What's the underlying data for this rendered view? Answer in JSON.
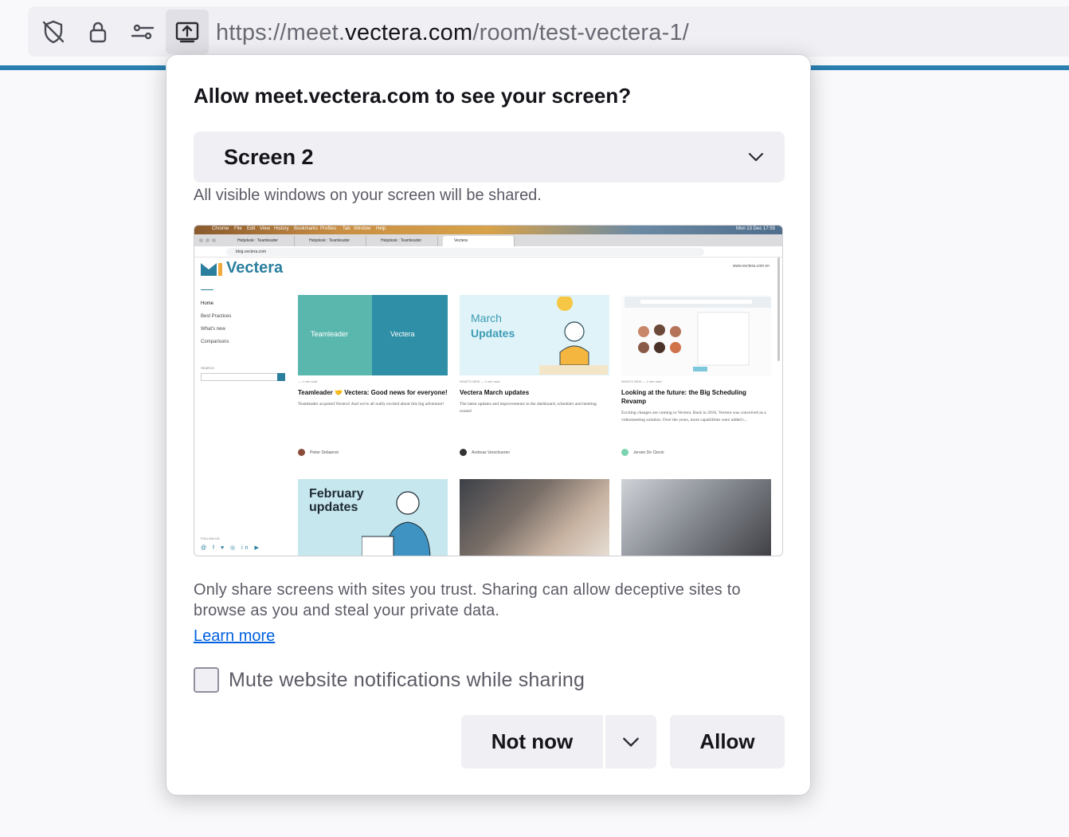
{
  "urlbar": {
    "url_prefix": "https://meet.",
    "url_host": "vectera.com",
    "url_path": "/room/test-vectera-1/",
    "icons": [
      "shield-slash-icon",
      "lock-icon",
      "permissions-icon",
      "screen-share-icon"
    ]
  },
  "accent_line_color": "#2a7fb0",
  "dialog": {
    "title": "Allow meet.vectera.com to see your screen?",
    "select": {
      "value": "Screen 2"
    },
    "select_hint": "All visible windows on your screen will be shared.",
    "warning": "Only share screens with sites you trust. Sharing can allow deceptive sites to browse as you and steal your private data.",
    "learn_more": "Learn more",
    "checkbox_label": "Mute website notifications while sharing",
    "checkbox_checked": false,
    "buttons": {
      "not_now": "Not now",
      "allow": "Allow"
    }
  },
  "preview": {
    "menubar": [
      "Chrome",
      "File",
      "Edit",
      "View",
      "History",
      "Bookmarks",
      "Profiles",
      "Tab",
      "Window",
      "Help"
    ],
    "menubar_right": "Mon 13 Dec  17:55",
    "tabs": [
      "Helpdesk : Teamleader",
      "Helpdesk : Teamleader",
      "Helpdesk : Teamleader",
      "Vectera"
    ],
    "address": "blog.vectera.com",
    "logo": "Vectera",
    "top_right": "www.vectera.com   en",
    "nav": [
      "Home",
      "Best Practices",
      "What's new",
      "Comparisons"
    ],
    "search_label": "SEARCH",
    "follow_label": "FOLLOW US",
    "social": "@ f ♥ ◎ in ▶",
    "cards": [
      {
        "img_left": "Teamleader",
        "img_right": "Vectera",
        "meta": "— 1 min read",
        "title": "Teamleader 🤝 Vectera: Good news for everyone!",
        "desc": "Teamleader acquired Vectera! And we're all really excited about this big adventure!",
        "author": "Pieter Debaenst"
      },
      {
        "img_text_1": "March",
        "img_text_2": "Updates",
        "meta": "WHAT'S NEW — 2 min read",
        "title": "Vectera March updates",
        "desc": "The latest updates and improvements in the dashboard, scheduler and meeting rooms!",
        "author": "Andreas Verschueren"
      },
      {
        "meta": "WHAT'S NEW — 2 min read",
        "title": "Looking at the future: the Big Scheduling Revamp",
        "desc": "Exciting changes are coming to Vectera. Back in 2016, Vectera was conceived as a videomeeting solution. Over the years, more capabilities were added t...",
        "author": "Jeroen De Clerck"
      }
    ],
    "feb_title_1": "February",
    "feb_title_2": "updates"
  }
}
